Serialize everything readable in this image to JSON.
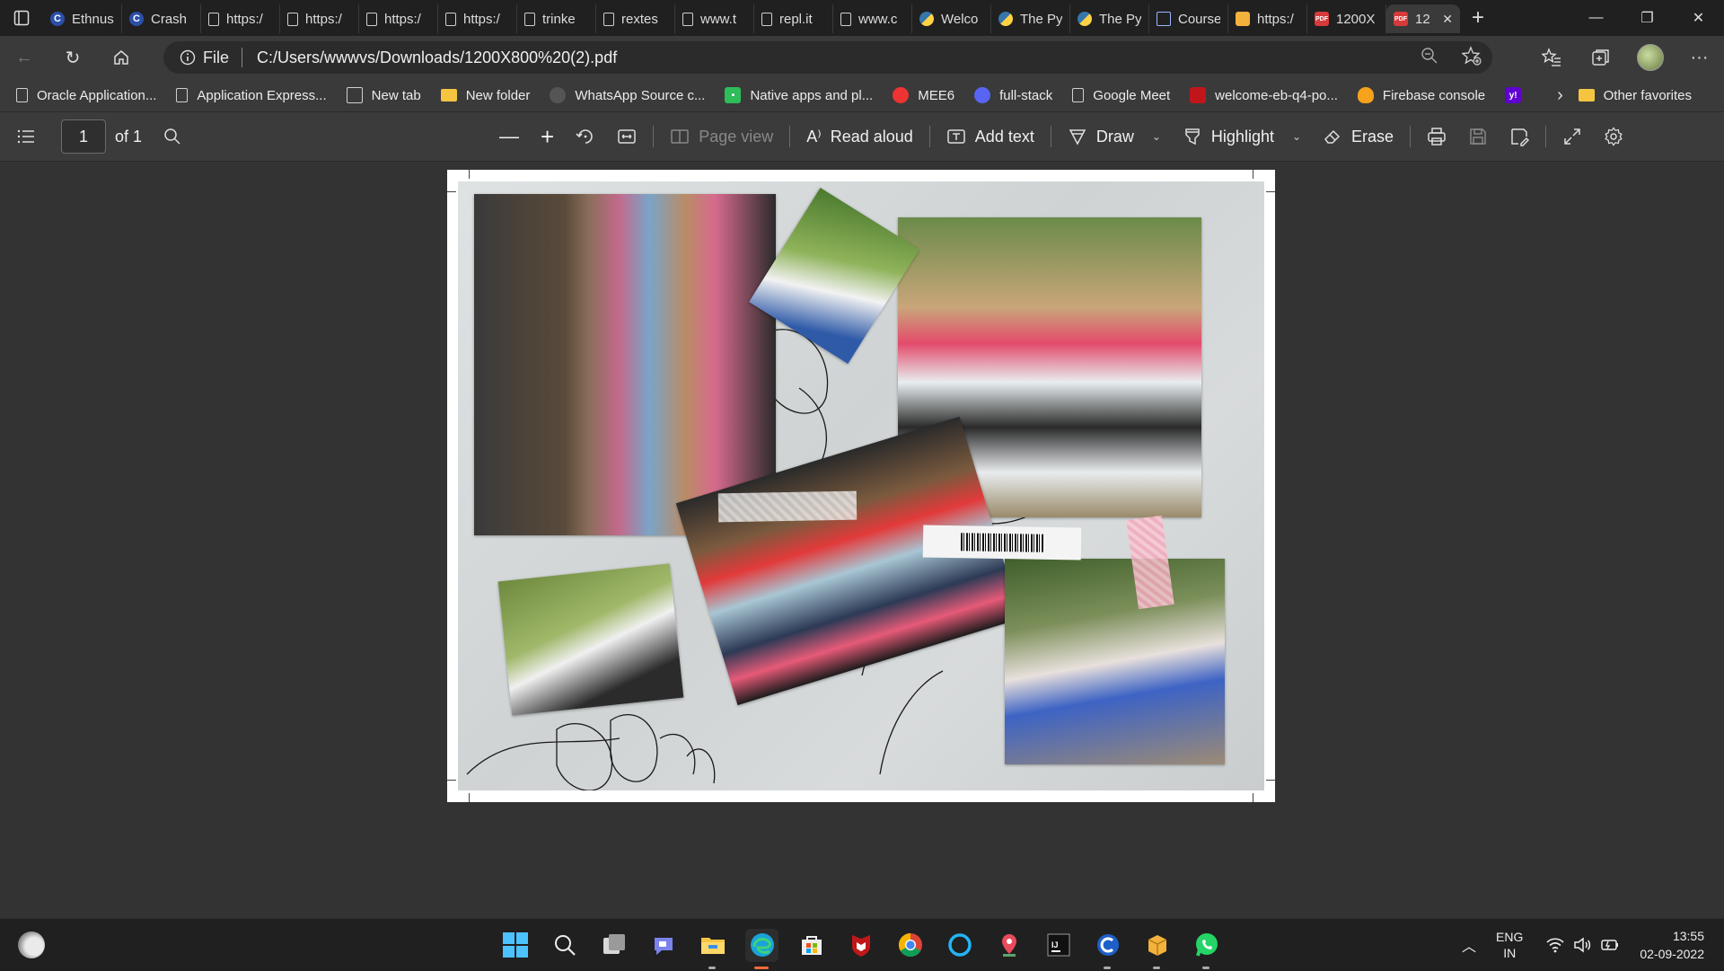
{
  "tabs": [
    {
      "label": "Ethnus",
      "icon": "c-logo-icon"
    },
    {
      "label": "Crash",
      "icon": "c-logo-icon"
    },
    {
      "label": "https:/",
      "icon": "page-icon"
    },
    {
      "label": "https:/",
      "icon": "page-icon"
    },
    {
      "label": "https:/",
      "icon": "page-icon"
    },
    {
      "label": "https:/",
      "icon": "page-icon"
    },
    {
      "label": "trinke",
      "icon": "page-icon"
    },
    {
      "label": "rextes",
      "icon": "page-icon"
    },
    {
      "label": "www.t",
      "icon": "page-icon"
    },
    {
      "label": "repl.it",
      "icon": "page-icon"
    },
    {
      "label": "www.c",
      "icon": "page-icon"
    },
    {
      "label": "Welco",
      "icon": "python-icon"
    },
    {
      "label": "The Py",
      "icon": "python-icon"
    },
    {
      "label": "The Py",
      "icon": "python-icon"
    },
    {
      "label": "Course",
      "icon": "course-icon"
    },
    {
      "label": "https:/",
      "icon": "package-icon"
    },
    {
      "label": "1200X",
      "icon": "pdf-icon"
    },
    {
      "label": "12",
      "icon": "pdf-icon",
      "active": true
    }
  ],
  "address": {
    "info_label": "File",
    "url": "C:/Users/wwwvs/Downloads/1200X800%20(2).pdf"
  },
  "bookmarks": [
    {
      "label": "Oracle Application...",
      "icon": "page"
    },
    {
      "label": "Application Express...",
      "icon": "page"
    },
    {
      "label": "New tab",
      "icon": "newtab"
    },
    {
      "label": "New folder",
      "icon": "folder"
    },
    {
      "label": "WhatsApp Source c...",
      "icon": "wa"
    },
    {
      "label": "Native apps and pl...",
      "icon": "green"
    },
    {
      "label": "MEE6",
      "icon": "mee"
    },
    {
      "label": "full-stack",
      "icon": "discord"
    },
    {
      "label": "Google Meet",
      "icon": "page"
    },
    {
      "label": "welcome-eb-q4-po...",
      "icon": "shield"
    },
    {
      "label": "Firebase console",
      "icon": "fire"
    }
  ],
  "bookmarks_other": "Other favorites",
  "pdf_toolbar": {
    "page_number": "1",
    "page_total": "of 1",
    "page_view": "Page view",
    "read_aloud": "Read aloud",
    "add_text": "Add text",
    "draw": "Draw",
    "highlight": "Highlight",
    "erase": "Erase"
  },
  "taskbar": {
    "lang_top": "ENG",
    "lang_bottom": "IN",
    "time": "13:55",
    "date": "02-09-2022"
  },
  "colors": {
    "tab_bg": "#202020",
    "toolbar_bg": "#3a3a3a",
    "doc_bg": "#333333",
    "accent": "#f06a3a"
  }
}
